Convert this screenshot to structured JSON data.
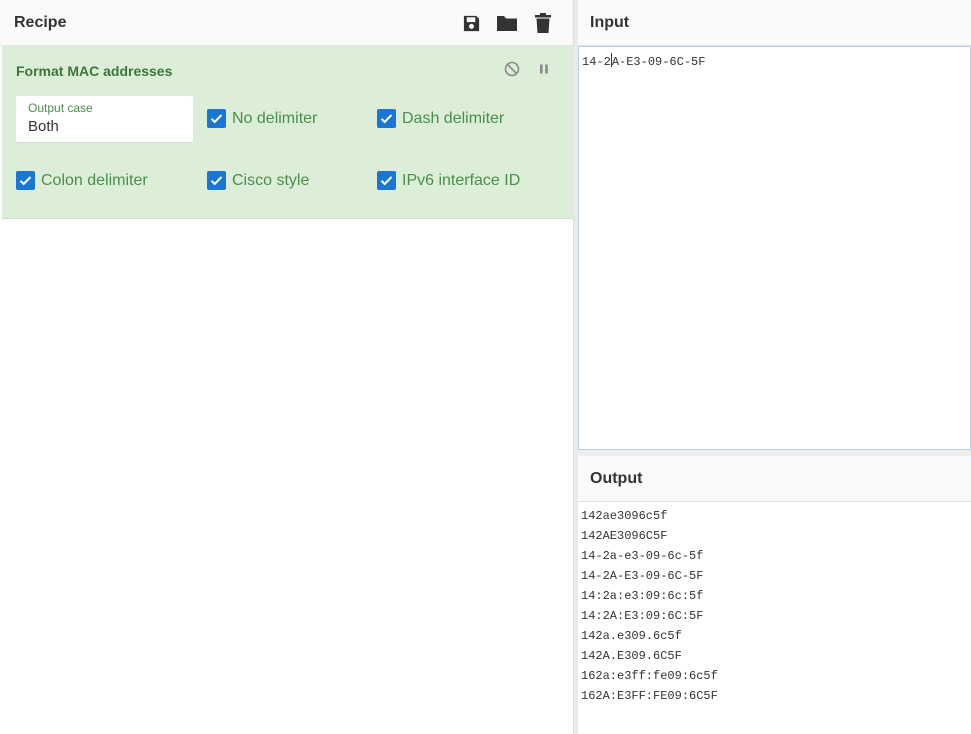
{
  "recipe": {
    "title": "Recipe",
    "icons": [
      "save-icon",
      "folder-icon",
      "trash-icon"
    ],
    "operation": {
      "name": "Format MAC addresses",
      "controls": [
        "disable-icon",
        "pause-icon"
      ],
      "output_case": {
        "label": "Output case",
        "value": "Both"
      },
      "checkboxes": [
        {
          "label": "No delimiter",
          "checked": true
        },
        {
          "label": "Dash delimiter",
          "checked": true
        },
        {
          "label": "Colon delimiter",
          "checked": true
        },
        {
          "label": "Cisco style",
          "checked": true
        },
        {
          "label": "IPv6 interface ID",
          "checked": true
        }
      ]
    }
  },
  "input": {
    "title": "Input",
    "value_before_caret": "14-2",
    "value_after_caret": "A-E3-09-6C-5F"
  },
  "output": {
    "title": "Output",
    "lines": [
      "142ae3096c5f",
      "142AE3096C5F",
      "14-2a-e3-09-6c-5f",
      "14-2A-E3-09-6C-5F",
      "14:2a:e3:09:6c:5f",
      "14:2A:E3:09:6C:5F",
      "142a.e309.6c5f",
      "142A.E309.6C5F",
      "162a:e3ff:fe09:6c5f",
      "162A:E3FF:FE09:6C5F"
    ]
  },
  "colors": {
    "operation_bg": "#dcedd8",
    "operation_text": "#3c763d",
    "checkbox": "#1976d2"
  }
}
